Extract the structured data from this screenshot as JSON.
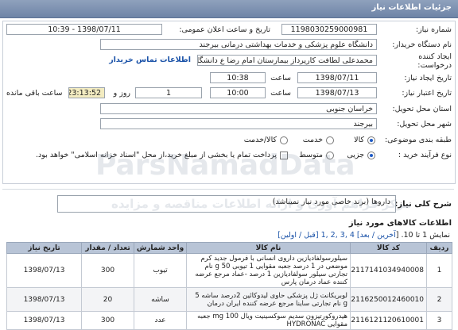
{
  "header": {
    "title": "جزئیات اطلاعات نیاز"
  },
  "form": {
    "need_number_label": "شماره نیاز:",
    "need_number": "1198030259000981",
    "announce_label": "تاریخ و ساعت اعلان عمومی:",
    "announce_value": "1398/07/11 - 10:39",
    "buyer_label": "نام دستگاه خریدار:",
    "buyer_value": "دانشگاه علوم پزشکی و خدمات بهداشتی درمانی بیرجند",
    "requester_label": "ایجاد کننده درخواست:",
    "requester_value": "محمدعلی لطافت کارپرداز بیمارستان امام رضا ع دانشگاه علوم پزشکی و خدمات",
    "contact_link": "اطلاعات تماس خریدار",
    "create_date_label": "تاریخ ایجاد نیاز:",
    "create_date": "1398/07/11",
    "create_time_label": "ساعت",
    "create_time": "10:38",
    "deadline_label": "تاریخ اعتبار نیاز:",
    "deadline_date": "1398/07/13",
    "deadline_time_label": "ساعت",
    "deadline_time": "10:00",
    "days_value": "1",
    "days_label": "روز و",
    "remaining_time": "23:13:52",
    "remaining_label": "ساعت باقی مانده",
    "province_label": "استان محل تحویل:",
    "province_value": "خراسان جنوبی",
    "city_label": "شهر محل تحویل:",
    "city_value": "بیرجند",
    "category_label": "طبقه بندی موضوعی:",
    "category_options": [
      "کالا",
      "خدمت",
      "کالا/خدمت"
    ],
    "purchase_type_label": "نوع فرآیند خرید :",
    "purchase_options": [
      "جزیی",
      "متوسط"
    ],
    "payment_note": "پرداخت تمام یا بخشی از مبلغ خرید،از محل \"اسناد خزانه اسلامی\" خواهد بود."
  },
  "general_desc": {
    "label": "شرح کلی نیاز:",
    "value": "داروها (برند خاصی مورد نیاز نمیباشد)"
  },
  "items_section": {
    "title": "اطلاعات کالاهای مورد نیاز",
    "pager_prefix": "نمایش 1 تا 10. [",
    "pager_links": "آخرین / بعد] 4 ,3 ,2 ,1 [قبل / اولین]",
    "columns": [
      "ردیف",
      "کد کالا",
      "نام کالا",
      "واحد شمارش",
      "تعداد / مقدار",
      "تاریخ نیاز"
    ],
    "rows": [
      {
        "index": "1",
        "code": "2117141034940008",
        "name": "سیلورسولفادیازین داروی انسانی با فرمول جدید کرم موضعی در 1 درصد جعبه مقوایی 1 تیوبی 50 g نام تجارتی سیلور سولفادیازین 1 درصد -عماد مرجع عرضه کننده عماد درمان پارس",
        "unit": "تیوب",
        "qty": "300",
        "date": "1398/07/13"
      },
      {
        "index": "2",
        "code": "2116250012460010",
        "name": "لوبریکانت ژل پزشکی حاوی لیدوکائین 2درصد ساشه 5 g نام تجارتی ساینا مرجع عرضه کننده ایران درمان",
        "unit": "ساشه",
        "qty": "20",
        "date": "1398/07/13"
      },
      {
        "index": "3",
        "code": "2116121120610001",
        "name": "هیدروکورتیزون سدیم سوکسینیت ویال 100 mg جعبه مقوایی HYDRONAC",
        "unit": "عدد",
        "qty": "300",
        "date": "1398/07/13"
      }
    ]
  },
  "watermark": {
    "text": "ParsNamadData",
    "subtext": "مرکز فراهم آوری و ارائه اطلاعات مناقصه و مزایده"
  }
}
